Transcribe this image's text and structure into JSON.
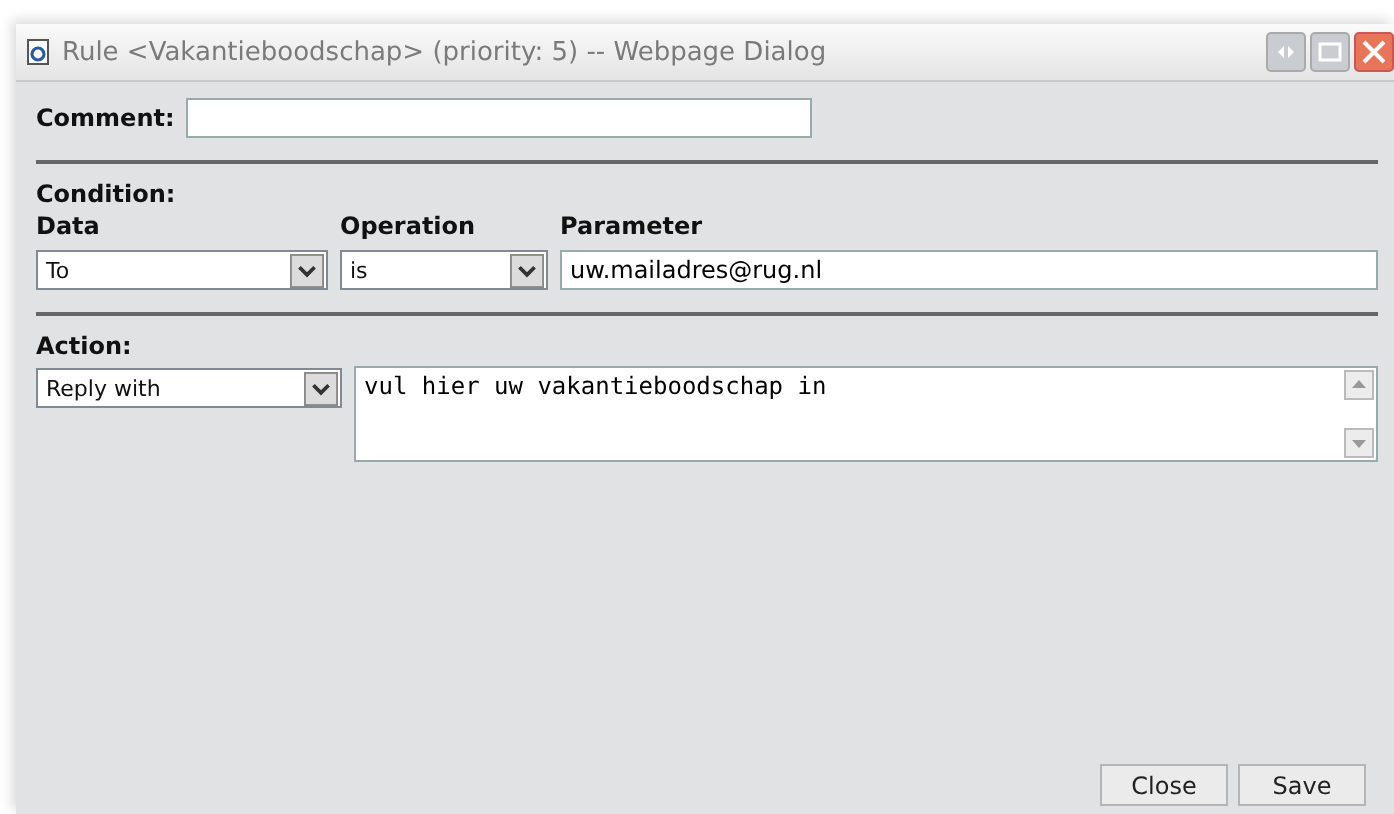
{
  "window": {
    "title": "Rule <Vakantieboodschap> (priority: 5) -- Webpage Dialog"
  },
  "comment": {
    "label": "Comment:"
  },
  "condition": {
    "heading": "Condition:",
    "columns": [
      "Data",
      "Operation",
      "Parameter"
    ],
    "data": "To",
    "operation": "is",
    "parameter": "uw.mailadres@rug.nl"
  },
  "action": {
    "heading": "Action:",
    "type": "Reply with",
    "message": "vul hier uw vakantieboodschap in"
  },
  "buttons": [
    "Close",
    "Save"
  ]
}
